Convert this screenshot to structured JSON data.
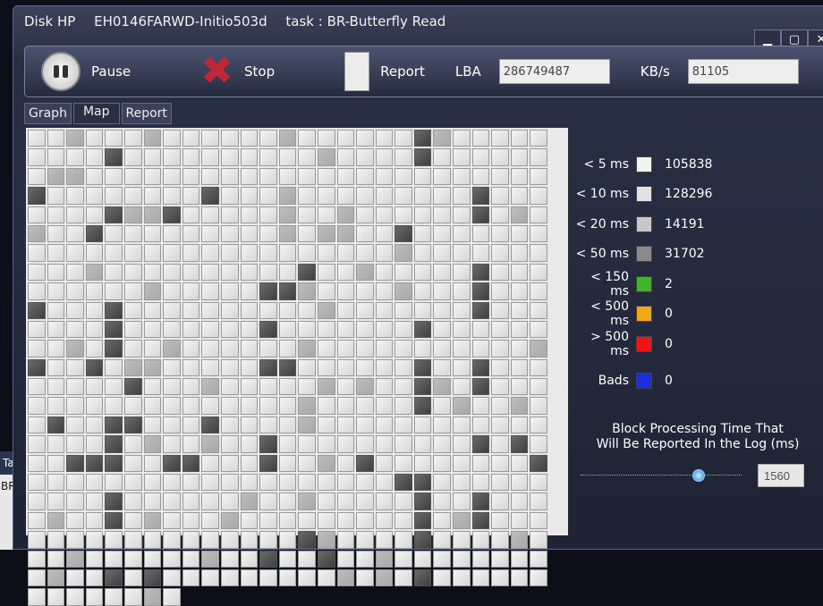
{
  "background_window": {
    "tab": "Tas",
    "row": "BR-B"
  },
  "window": {
    "title_disk": "Disk HP",
    "title_model": "EH0146FARWD-Initio503d",
    "title_task": "task : BR-Butterfly Read",
    "min": "▁",
    "max": "▢",
    "close": "✕"
  },
  "toolbar": {
    "pause": "Pause",
    "stop": "Stop",
    "report": "Report",
    "lba_label": "LBA",
    "lba_value": "286749487",
    "speed_label": "KB/s",
    "speed_value": "81105"
  },
  "tabs": [
    {
      "label": "Graph"
    },
    {
      "label": "Map",
      "active": true
    },
    {
      "label": "Report"
    }
  ],
  "map": {
    "total_cells": 656
  },
  "legend": [
    {
      "label": "< 5 ms",
      "color": "#f2f2f2",
      "count": "105838"
    },
    {
      "label": "< 10 ms",
      "color": "#e2e2e2",
      "count": "128296"
    },
    {
      "label": "< 20 ms",
      "color": "#c8c8c8",
      "count": "14191"
    },
    {
      "label": "< 50 ms",
      "color": "#8a8a8a",
      "count": "31702"
    },
    {
      "label": "< 150 ms",
      "color": "#3fb52c",
      "count": "2"
    },
    {
      "label": "< 500 ms",
      "color": "#f0a818",
      "count": "0"
    },
    {
      "label": "> 500 ms",
      "color": "#f01414",
      "count": "0"
    },
    {
      "label": "Bads",
      "color": "#1a2ee0",
      "count": "0"
    }
  ],
  "threshold": {
    "caption_line1": "Block Processing Time That",
    "caption_line2": "Will Be Reported In the Log (ms)",
    "value": "1560",
    "slider_fraction": 0.75
  }
}
